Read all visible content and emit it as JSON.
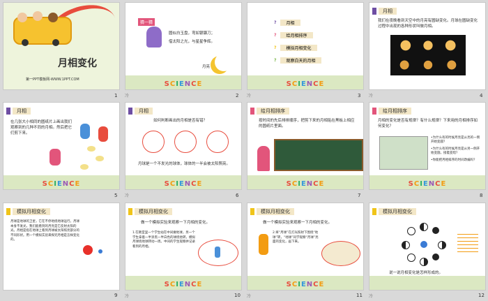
{
  "slides": [
    {
      "num": "1",
      "title": "月相变化",
      "footer": "第一PPT模板网-WWW.1PPT.COM"
    },
    {
      "num": "2",
      "note": "冷",
      "badge": "猜一猜",
      "riddle_line1": "圆似白玉盘，弯如银镰刀；",
      "riddle_line2": "借太阳之光，与星星争辉。",
      "answer": "月亮"
    },
    {
      "num": "3",
      "note": "冷",
      "menu": [
        "月相",
        "给月相排序",
        "模拟月相变化",
        "观察白天的月相"
      ]
    },
    {
      "num": "4",
      "note": "冷",
      "title": "月相",
      "text": "我们在夜晚看到天空中的月亮有圆缺变化。月球在圆缺变化过程中出现的各种形状叫做月相。"
    },
    {
      "num": "5",
      "title": "月相",
      "text": "在几张大小相同的圆纸片上画出我们观察到的几种不同的月相。然后把它们剪下来。"
    },
    {
      "num": "6",
      "note": "冷",
      "title": "月相",
      "question": "如何判断画出的月相是否有错？",
      "text": "月球是一个不发光的球体，球体的一半会被太阳照亮。"
    },
    {
      "num": "7",
      "title": "给月相排序",
      "text": "按时间的先后排排顺序，把剪下来的月相贴在黑板上相应的圆纸片里面。"
    },
    {
      "num": "8",
      "title": "给月相排序",
      "question": "月相的变化是否有规律？有什么规律？下来用的月相排序如何变化？",
      "bullets": [
        "•为什么有的时候月亮是从亮的一侧开始变圆？",
        "•为什么有的时候月亮是从另一侧开始变圆，接着变暗？",
        "•你能把月相排序的时间改编吗？"
      ]
    },
    {
      "num": "9",
      "title": "模拟月相变化",
      "text": "月球是地球的卫星，它在不停地绕地球运行。月球本身不发光，我们能看到的月亮是它反射太阳的光。月相是指在地球上看到月球被太阳照亮部分的不同形状。用一个模拟实验来探究月相是怎样变化的。"
    },
    {
      "num": "10",
      "note": "冷",
      "title": "模拟月相变化",
      "subtitle": "做一个模拟实验来观察一下月相的变化。",
      "text": "1.在教室里一个学生站在中间做地球，另一个学生拿着一半涂黑一半白色的球绕他转，模拟月球绕地球转动一周。中间的学生观察并记录看到的月相。"
    },
    {
      "num": "11",
      "note": "冷",
      "title": "模拟月相变化",
      "subtitle": "做一个模拟实验来观察一下月相的变化。",
      "text": "2.将“月球”在灯光照射下围绕“地球”转，“地球”同学观察“月球”亮面的变化，画下来。"
    },
    {
      "num": "12",
      "note": "冷",
      "title": "模拟月相变化",
      "caption": "说一说月相变化是怎样形成的。"
    }
  ],
  "science_word": [
    "S",
    "C",
    "I",
    "E",
    "N",
    "C",
    "E"
  ],
  "science_colors": [
    "#e84c3d",
    "#f39c12",
    "#27ae60",
    "#3498db",
    "#9b59b6",
    "#e84c3d",
    "#f39c12"
  ],
  "menu_icon_colors": [
    "#6e4ea3",
    "#e2557b",
    "#f0c419",
    "#7ab648"
  ]
}
